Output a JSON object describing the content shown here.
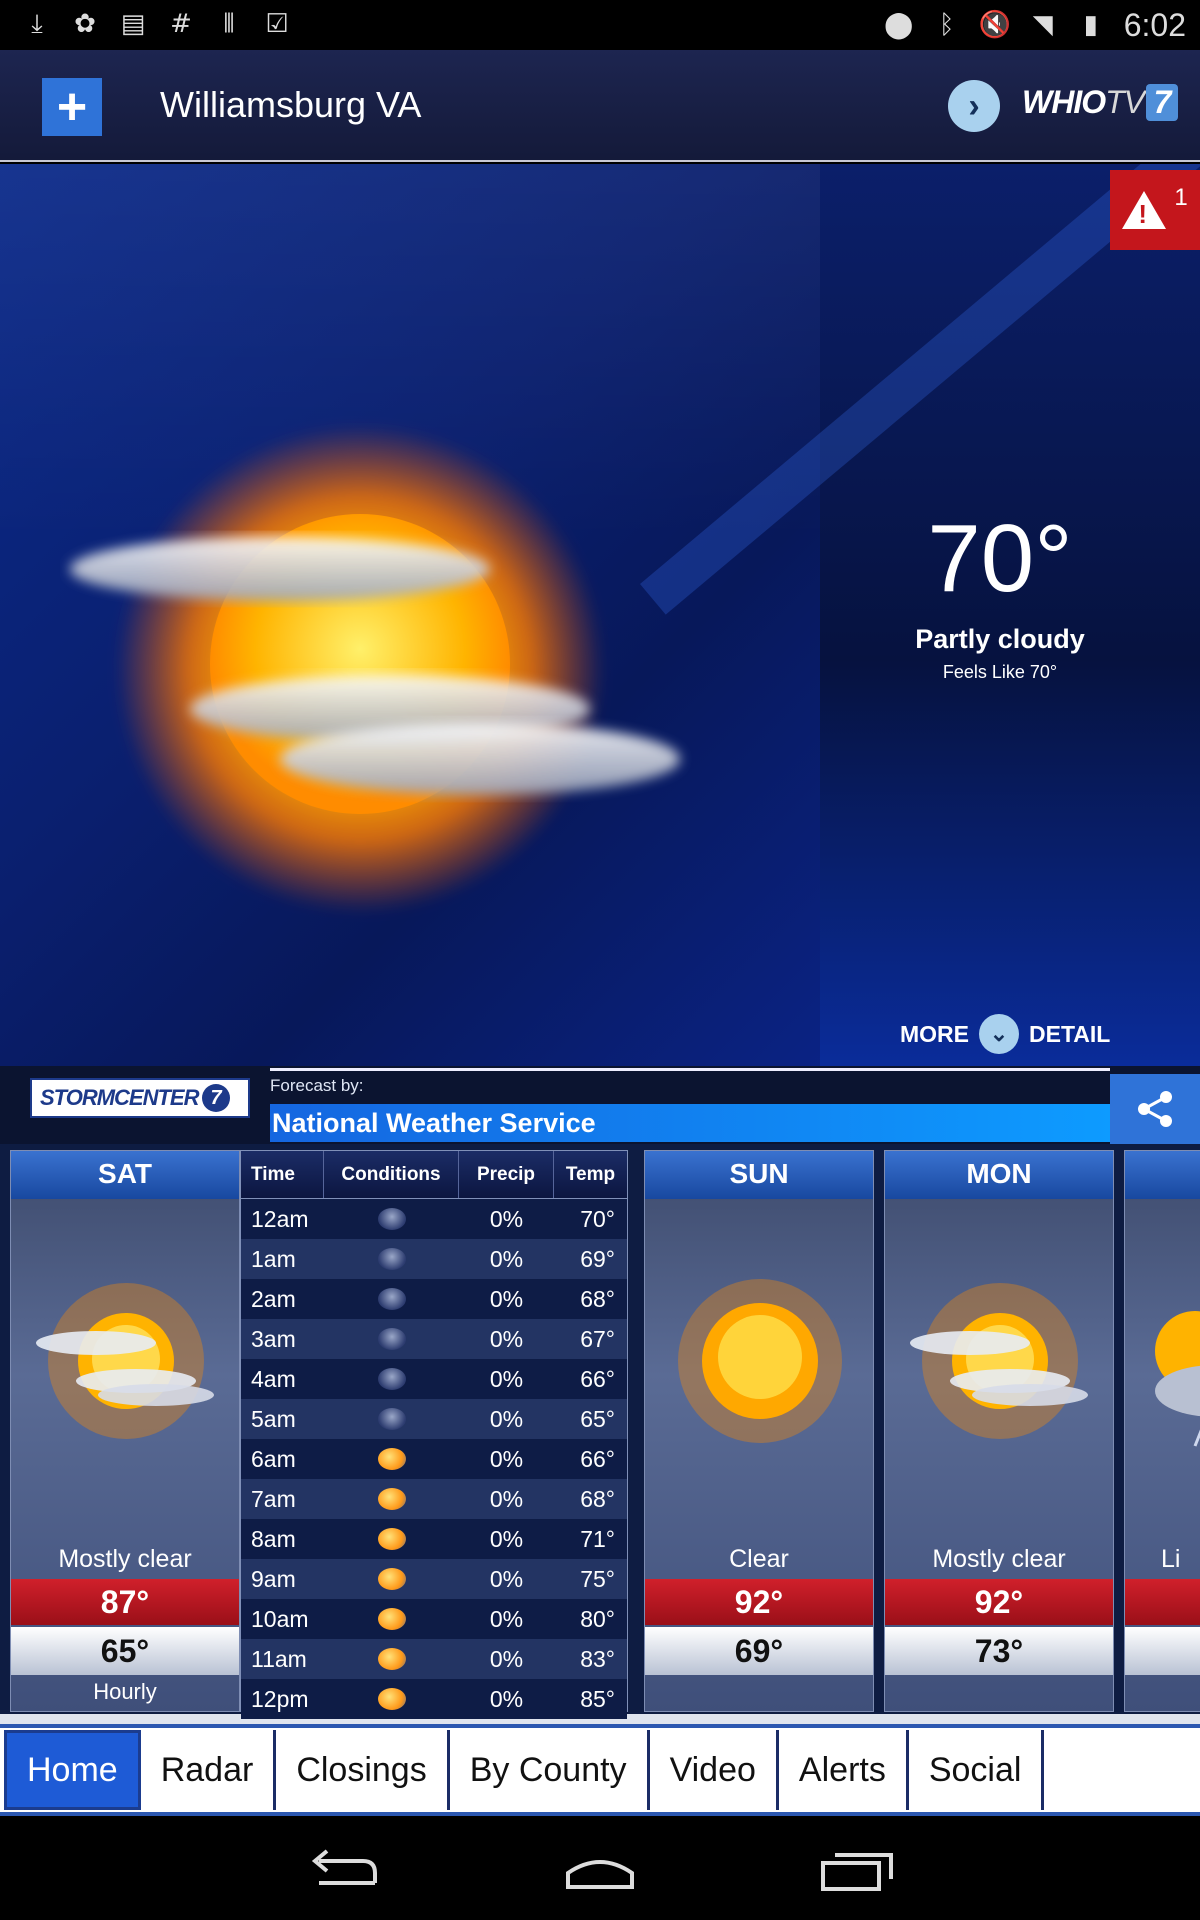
{
  "status_bar": {
    "time": "6:02",
    "left_icons": [
      "download-icon",
      "image-icon",
      "news-icon",
      "hashtag-icon",
      "barcode-icon",
      "check-icon"
    ],
    "right_icons": [
      "location-icon",
      "bluetooth-icon",
      "mute-icon",
      "wifi-icon",
      "battery-icon"
    ]
  },
  "header": {
    "location": "Williamsburg VA",
    "add_icon": "plus-icon",
    "next_icon": "chevron-right-icon",
    "brand": "WHIO",
    "brand_tv": "TV",
    "brand_num": "7"
  },
  "current": {
    "temperature": "70°",
    "condition": "Partly cloudy",
    "feels_like": "Feels Like 70°",
    "alert_count": "1",
    "more": "MORE",
    "detail": "DETAIL"
  },
  "forecast_by": {
    "logo_text": "STORMCENTER",
    "logo_num": "7",
    "label": "Forecast by:",
    "provider": "National Weather Service"
  },
  "days": [
    {
      "day": "SAT",
      "condition": "Mostly clear",
      "high": "87°",
      "low": "65°",
      "hourly": "Hourly",
      "icon": "partly-cloudy-icon"
    },
    {
      "day": "SUN",
      "condition": "Clear",
      "high": "92°",
      "low": "69°",
      "icon": "sun-icon"
    },
    {
      "day": "MON",
      "condition": "Mostly clear",
      "high": "92°",
      "low": "73°",
      "icon": "partly-cloudy-icon"
    },
    {
      "day": "",
      "condition": "Li",
      "icon": "storm-icon"
    }
  ],
  "hourly": {
    "headers": {
      "time": "Time",
      "conditions": "Conditions",
      "precip": "Precip",
      "temp": "Temp"
    },
    "rows": [
      {
        "time": "12am",
        "precip": "0%",
        "temp": "70°",
        "icon": "night-cloudy"
      },
      {
        "time": "1am",
        "precip": "0%",
        "temp": "69°",
        "icon": "night-cloudy"
      },
      {
        "time": "2am",
        "precip": "0%",
        "temp": "68°",
        "icon": "night-cloudy"
      },
      {
        "time": "3am",
        "precip": "0%",
        "temp": "67°",
        "icon": "night-cloudy"
      },
      {
        "time": "4am",
        "precip": "0%",
        "temp": "66°",
        "icon": "night-cloudy"
      },
      {
        "time": "5am",
        "precip": "0%",
        "temp": "65°",
        "icon": "night-cloudy"
      },
      {
        "time": "6am",
        "precip": "0%",
        "temp": "66°",
        "icon": "day-cloudy"
      },
      {
        "time": "7am",
        "precip": "0%",
        "temp": "68°",
        "icon": "day-cloudy"
      },
      {
        "time": "8am",
        "precip": "0%",
        "temp": "71°",
        "icon": "day-cloudy"
      },
      {
        "time": "9am",
        "precip": "0%",
        "temp": "75°",
        "icon": "day-cloudy"
      },
      {
        "time": "10am",
        "precip": "0%",
        "temp": "80°",
        "icon": "day-cloudy"
      },
      {
        "time": "11am",
        "precip": "0%",
        "temp": "83°",
        "icon": "day-cloudy"
      },
      {
        "time": "12pm",
        "precip": "0%",
        "temp": "85°",
        "icon": "day-cloudy"
      }
    ]
  },
  "tabs": [
    "Home",
    "Radar",
    "Closings",
    "By County",
    "Video",
    "Alerts",
    "Social"
  ],
  "colors": {
    "accent": "#2f73d8",
    "high_temp": "#c4161c",
    "tab_active": "#1e5bd6"
  }
}
